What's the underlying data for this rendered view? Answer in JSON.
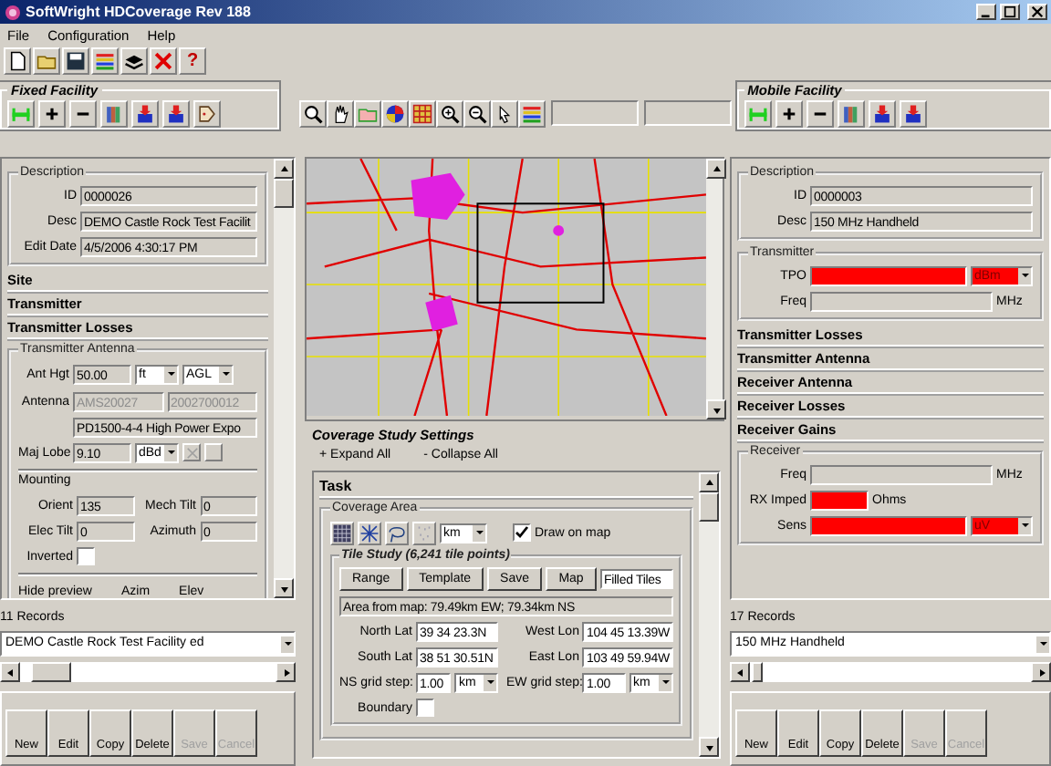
{
  "window": {
    "title": "SoftWright HDCoverage Rev 188"
  },
  "menu": [
    "File",
    "Configuration",
    "Help"
  ],
  "help_button": "?",
  "fixed_facility": {
    "title": "Fixed Facility",
    "description": {
      "title": "Description",
      "fields": [
        {
          "label": "ID",
          "value": "0000026"
        },
        {
          "label": "Desc",
          "value": "DEMO Castle Rock Test Facilit"
        },
        {
          "label": "Edit Date",
          "value": "4/5/2006 4:30:17 PM"
        }
      ]
    },
    "sections": [
      "Site",
      "Transmitter",
      "Transmitter Losses"
    ],
    "antenna": {
      "title": "Transmitter Antenna",
      "height": {
        "label": "Ant Hgt",
        "value": "50.00",
        "unit": "ft",
        "reference": "AGL"
      },
      "antenna": {
        "label": "Antenna",
        "codes": [
          {
            "value": "AMS20027",
            "disabled": true
          },
          {
            "value": "2002700012",
            "disabled": true
          }
        ],
        "model": "PD1500-4-4 High Power Expo"
      },
      "major_lobe": {
        "label": "Maj Lobe",
        "value": "9.10",
        "unit": "dBd"
      },
      "mounting": {
        "title": "Mounting",
        "fields": [
          {
            "label": "Orient",
            "value": "135"
          },
          {
            "label": "Mech Tilt",
            "value": "0"
          },
          {
            "label": "Elec Tilt",
            "value": "0"
          },
          {
            "label": "Azimuth",
            "value": "0"
          }
        ],
        "inverted": {
          "label": "Inverted",
          "checked": false
        }
      },
      "preview": {
        "label": "Hide preview",
        "columns": [
          "Azim",
          "Elev"
        ]
      }
    },
    "record_count": "11 Records",
    "record": "DEMO Castle Rock Test Facility ed",
    "buttons": [
      {
        "label": "New",
        "disabled": false
      },
      {
        "label": "Edit",
        "disabled": false
      },
      {
        "label": "Copy",
        "disabled": false
      },
      {
        "label": "Delete",
        "disabled": false
      },
      {
        "label": "Save",
        "disabled": true
      },
      {
        "label": "Cancel",
        "disabled": true
      }
    ]
  },
  "coverage_study": {
    "title": "Coverage Study Settings",
    "expand": "+ Expand All",
    "collapse": "- Collapse All",
    "task": "Task",
    "area_title": "Coverage Area",
    "unit": "km",
    "draw_on_map": {
      "label": "Draw on map",
      "checked": true
    },
    "tile_study": "Tile Study (6,241 tile points)",
    "buttons": [
      "Range",
      "Template",
      "Save",
      "Map"
    ],
    "fill_mode": "Filled Tiles",
    "area_note": "Area from map: 79.49km EW; 79.34km NS",
    "coords": [
      {
        "label": "North Lat",
        "value": "39 34 23.3N"
      },
      {
        "label": "West Lon",
        "value": "104 45 13.39W"
      },
      {
        "label": "South Lat",
        "value": "38 51 30.51N"
      },
      {
        "label": "East Lon",
        "value": "103 49 59.94W"
      }
    ],
    "steps": [
      {
        "label": "NS grid step:",
        "value": "1.00",
        "unit": "km"
      },
      {
        "label": "EW grid step:",
        "value": "1.00",
        "unit": "km"
      }
    ],
    "boundary": {
      "label": "Boundary",
      "checked": false
    }
  },
  "mobile_facility": {
    "title": "Mobile Facility",
    "description": {
      "title": "Description",
      "fields": [
        {
          "label": "ID",
          "value": "0000003"
        },
        {
          "label": "Desc",
          "value": "150 MHz Handheld"
        }
      ]
    },
    "transmitter": {
      "title": "Transmitter",
      "fields": [
        {
          "label": "TPO",
          "invalid": true,
          "unit": "dBm",
          "kind": "select"
        },
        {
          "label": "Freq",
          "invalid": false,
          "unit": "MHz",
          "kind": "text"
        }
      ]
    },
    "sections": [
      "Transmitter Losses",
      "Transmitter Antenna",
      "Receiver Antenna",
      "Receiver Losses",
      "Receiver Gains"
    ],
    "receiver": {
      "title": "Receiver",
      "fields": [
        {
          "label": "Freq",
          "invalid": false,
          "unit": "MHz",
          "kind": "text"
        },
        {
          "label": "RX Imped",
          "invalid": true,
          "unit": "Ohms",
          "kind": "short"
        },
        {
          "label": "Sens",
          "invalid": true,
          "unit": "uV",
          "kind": "select"
        }
      ]
    },
    "record_count": "17 Records",
    "record": "150 MHz Handheld",
    "buttons": [
      {
        "label": "New",
        "disabled": false
      },
      {
        "label": "Edit",
        "disabled": false
      },
      {
        "label": "Copy",
        "disabled": false
      },
      {
        "label": "Delete",
        "disabled": false
      },
      {
        "label": "Save",
        "disabled": true
      },
      {
        "label": "Cancel",
        "disabled": true
      }
    ]
  }
}
